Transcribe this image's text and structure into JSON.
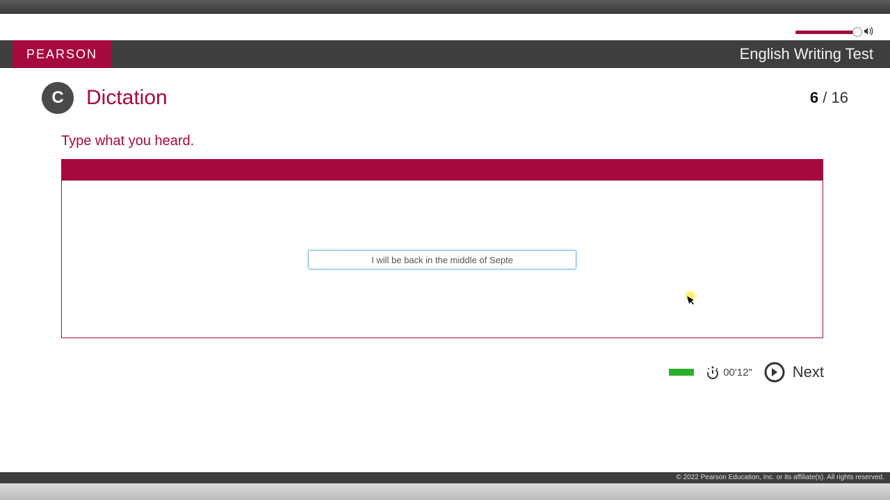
{
  "header": {
    "brand": "PEARSON",
    "test_title": "English Writing Test"
  },
  "section": {
    "letter": "C",
    "title": "Dictation"
  },
  "progress": {
    "current": "6",
    "total": "16"
  },
  "instruction": "Type what you heard.",
  "answer": {
    "value": "I will be back in the middle of Septe"
  },
  "timer": {
    "display": "00'12\""
  },
  "next_label": "Next",
  "footer": "© 2022 Pearson Education, Inc. or its affiliate(s). All rights reserved."
}
